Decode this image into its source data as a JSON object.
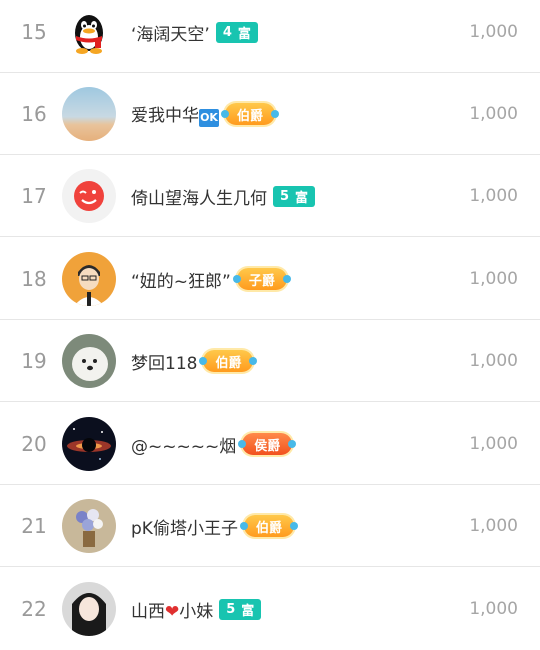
{
  "rows": [
    {
      "rank": "15",
      "name": "‘海阔天空’",
      "badge_type": "wealth",
      "badge_text": "富",
      "badge_level": "4",
      "score": "1,000",
      "avatar_icon": "qq-penguin"
    },
    {
      "rank": "16",
      "name_prefix": "爱我中华",
      "name_emoji": "OK",
      "badge_type": "noble",
      "badge_text": "伯爵",
      "score": "1,000",
      "avatar_icon": "sky-photo"
    },
    {
      "rank": "17",
      "name": "倚山望海人生几何",
      "badge_type": "wealth",
      "badge_text": "富",
      "badge_level": "5",
      "score": "1,000",
      "avatar_icon": "red-emoji-face"
    },
    {
      "rank": "18",
      "name": "“妞的~狂郎”",
      "badge_type": "noble",
      "badge_text": "子爵",
      "score": "1,000",
      "avatar_icon": "cartoon-man"
    },
    {
      "rank": "19",
      "name": "梦回118",
      "badge_type": "noble",
      "badge_text": "伯爵",
      "score": "1,000",
      "avatar_icon": "dog-photo"
    },
    {
      "rank": "20",
      "name": "@~~~~~烟",
      "badge_type": "noble",
      "badge_text": "侯爵",
      "score": "1,000",
      "avatar_icon": "space-photo"
    },
    {
      "rank": "21",
      "name": "pK偷塔小王子",
      "badge_type": "noble",
      "badge_text": "伯爵",
      "score": "1,000",
      "avatar_icon": "flower-photo"
    },
    {
      "rank": "22",
      "name_prefix": "山西",
      "name_heart": "❤",
      "name_suffix": "小妹",
      "badge_type": "wealth",
      "badge_text": "富",
      "badge_level": "5",
      "score": "1,000",
      "avatar_icon": "woman-photo"
    }
  ]
}
